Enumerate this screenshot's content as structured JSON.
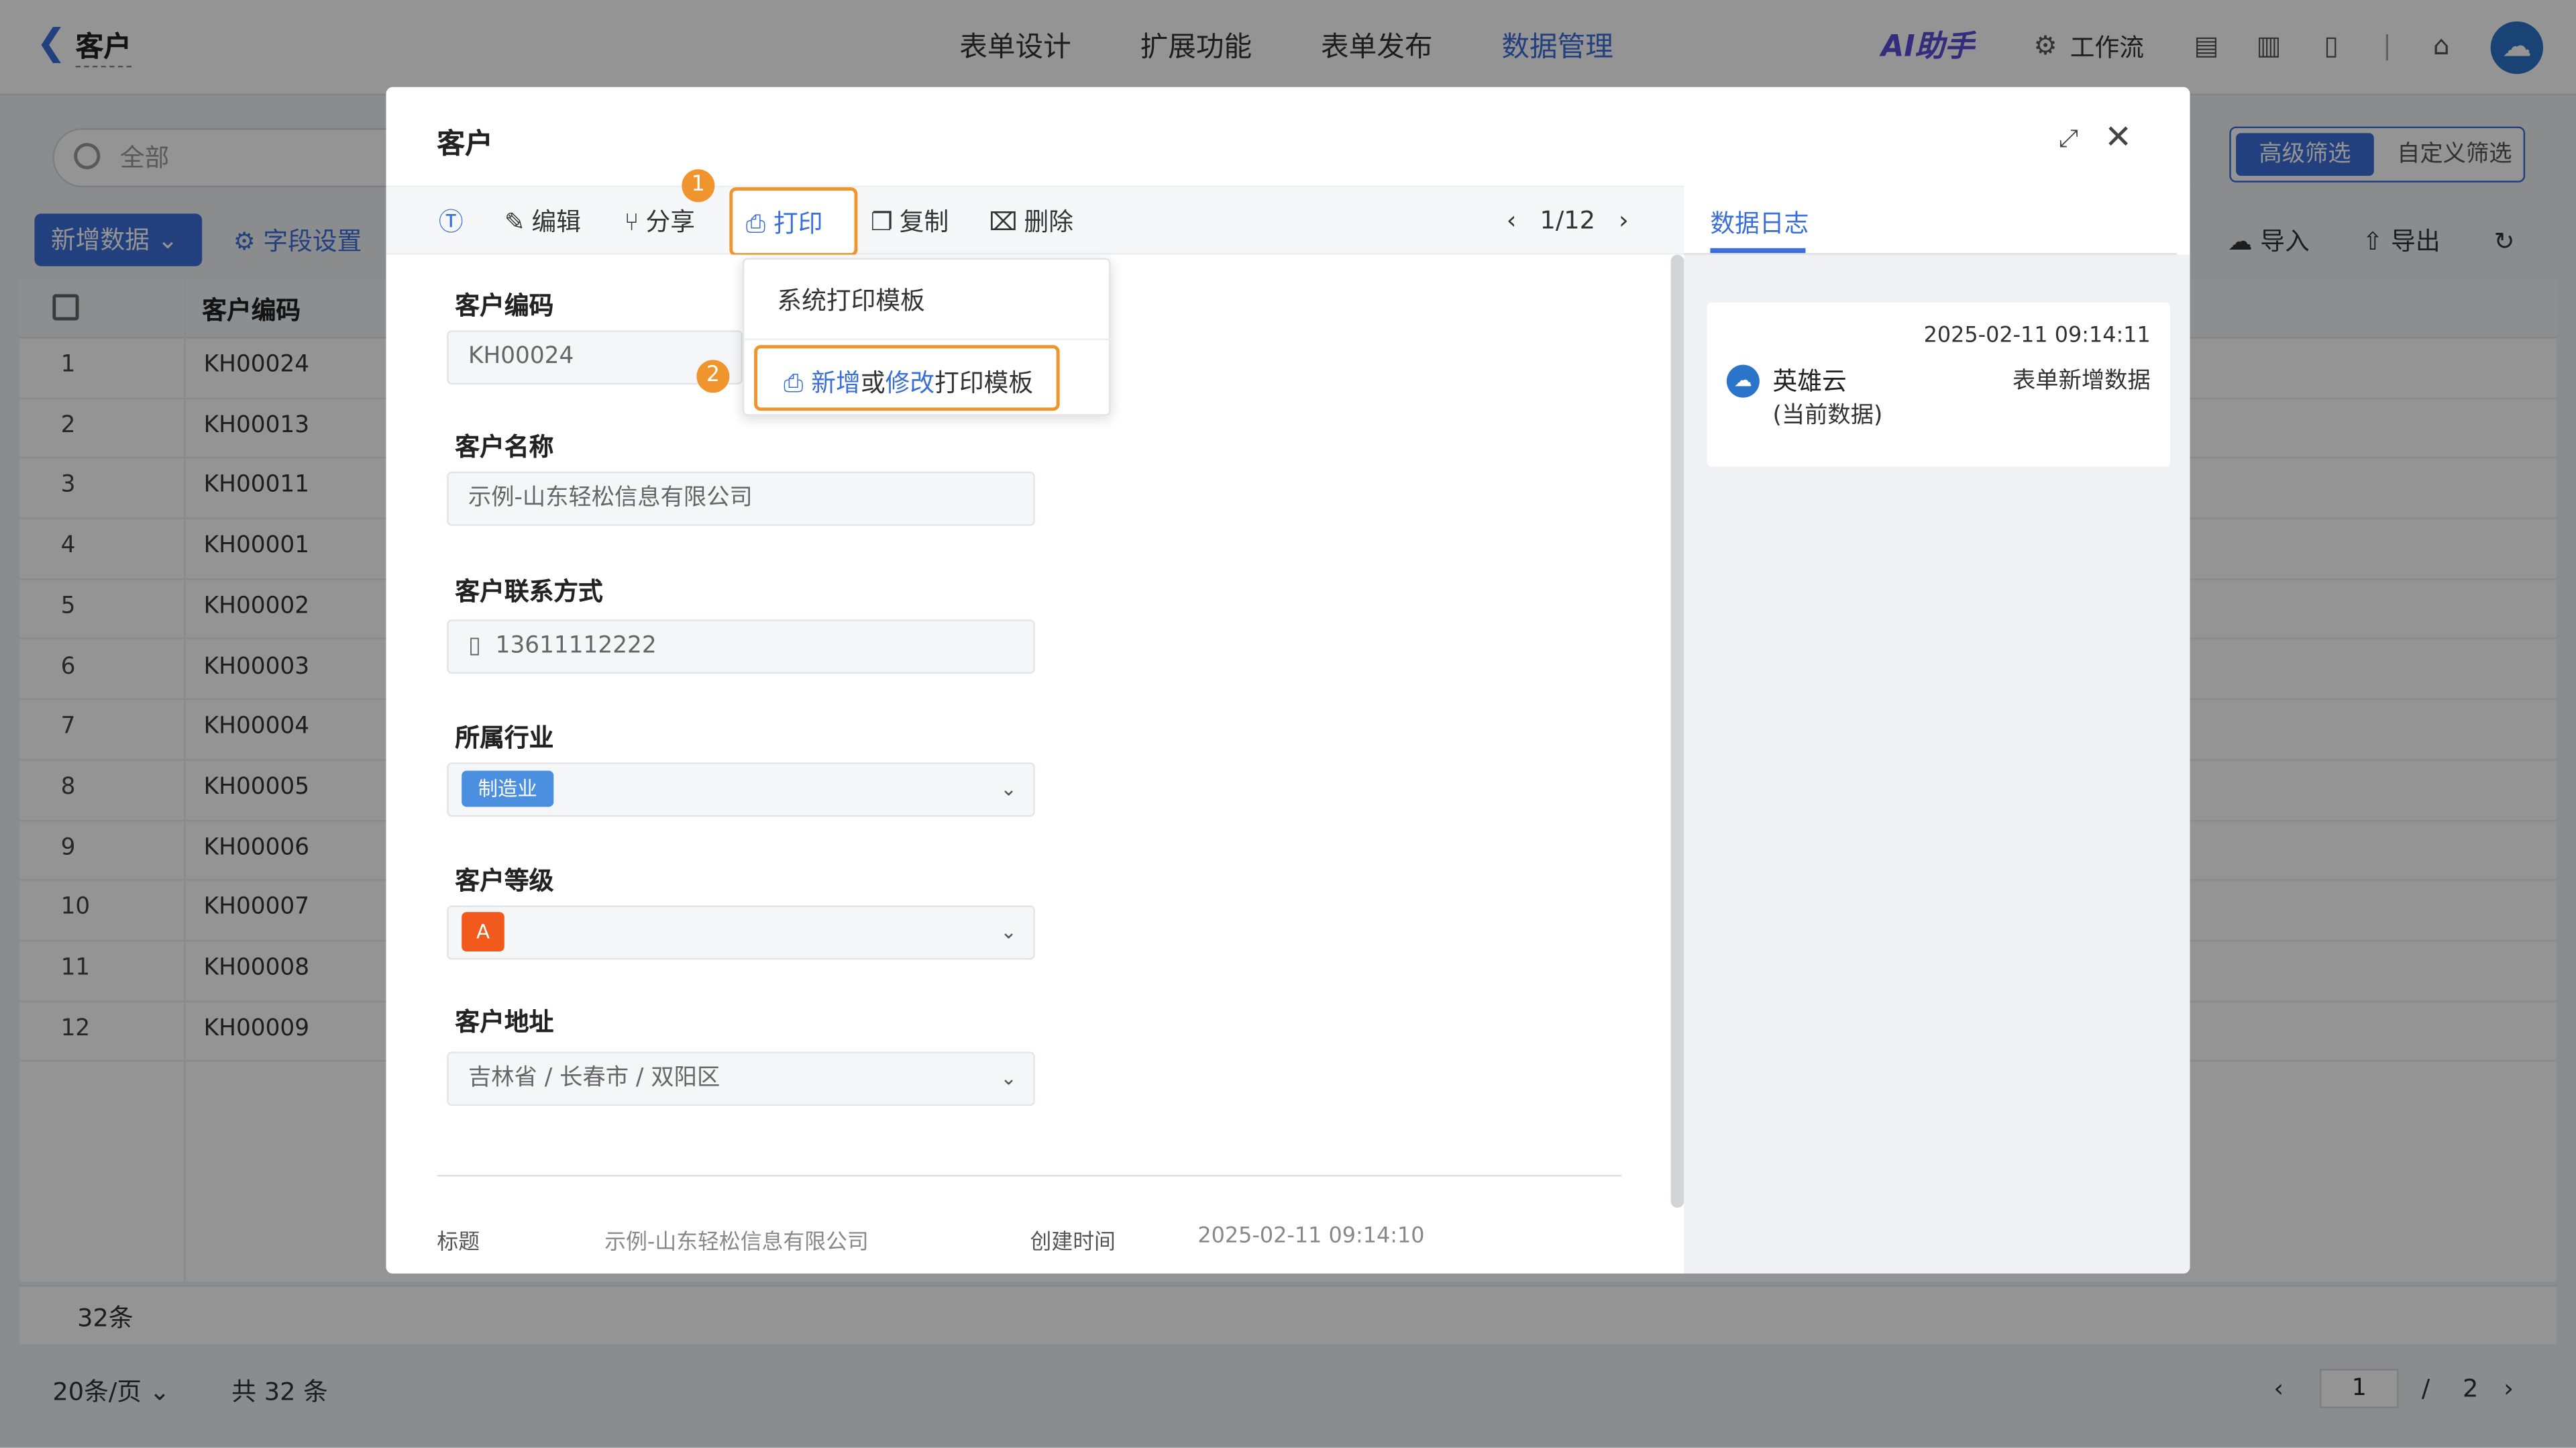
{
  "header": {
    "back_icon": "chevron-left-icon",
    "title": "客户",
    "nav": [
      "表单设计",
      "扩展功能",
      "表单发布",
      "数据管理"
    ],
    "active_nav": "数据管理",
    "ai_label": "AI助手",
    "workflow_label": "工作流"
  },
  "background": {
    "search_placeholder": "全部",
    "add_button": "新增数据",
    "field_settings": "字段设置",
    "filter_advanced": "高级筛选",
    "filter_custom": "自定义筛选",
    "import": "导入",
    "export": "导出",
    "table_header": "客户编码",
    "rows": [
      {
        "n": "1",
        "code": "KH00024"
      },
      {
        "n": "2",
        "code": "KH00013"
      },
      {
        "n": "3",
        "code": "KH00011"
      },
      {
        "n": "4",
        "code": "KH00001"
      },
      {
        "n": "5",
        "code": "KH00002"
      },
      {
        "n": "6",
        "code": "KH00003"
      },
      {
        "n": "7",
        "code": "KH00004"
      },
      {
        "n": "8",
        "code": "KH00005"
      },
      {
        "n": "9",
        "code": "KH00006"
      },
      {
        "n": "10",
        "code": "KH00007"
      },
      {
        "n": "11",
        "code": "KH00008"
      },
      {
        "n": "12",
        "code": "KH00009"
      }
    ],
    "sum_label": "32条",
    "page_size": "20条/页",
    "total": "共 32 条",
    "current_page": "1",
    "page_sep": "/",
    "page_count": "2"
  },
  "modal": {
    "title": "客户",
    "toolbar": {
      "edit": "编辑",
      "share": "分享",
      "print": "打印",
      "copy": "复制",
      "delete": "删除",
      "pager": "1/12"
    },
    "badges": [
      "1",
      "2"
    ],
    "dropdown": {
      "system_template": "系统打印模板",
      "new_part": "新增",
      "or_part": "或",
      "modify_part": "修改",
      "template_part": "打印模板"
    },
    "fields": {
      "code_label": "客户编码",
      "code_value": "KH00024",
      "name_label": "客户名称",
      "name_value": "示例-山东轻松信息有限公司",
      "contact_label": "客户联系方式",
      "contact_value": "13611112222",
      "industry_label": "所属行业",
      "industry_value": "制造业",
      "level_label": "客户等级",
      "level_value": "A",
      "address_label": "客户地址",
      "address_value": "吉林省 / 长春市 / 双阳区"
    },
    "meta": {
      "title_label": "标题",
      "title_value": "示例-山东轻松信息有限公司",
      "created_label": "创建时间",
      "created_value": "2025-02-11 09:14:10"
    },
    "log": {
      "tab": "数据日志",
      "time": "2025-02-11 09:14:11",
      "user": "英雄云",
      "user_sub": "(当前数据)",
      "action": "表单新增数据"
    }
  },
  "colors": {
    "accent": "#3a6ed8",
    "highlight": "#f0952e",
    "level_a": "#f25a1d",
    "industry_tag": "#4a8fe0"
  }
}
